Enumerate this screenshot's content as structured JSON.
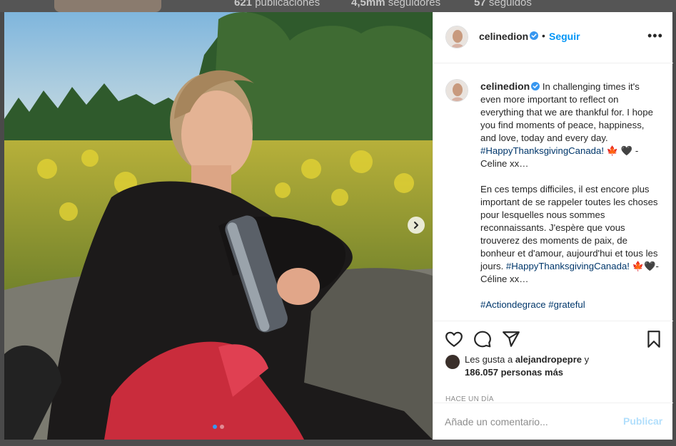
{
  "background_profile": {
    "stats": [
      {
        "value": "621",
        "label": "publicaciones"
      },
      {
        "value": "4,5mm",
        "label": "seguidores"
      },
      {
        "value": "57",
        "label": "seguidos"
      }
    ]
  },
  "post": {
    "username": "celinedion",
    "follow_label": "Seguir",
    "bullet": "•",
    "more_label": "•••",
    "caption": {
      "username": "celinedion",
      "en_text": " In challenging times it's even more important to reflect on everything that we are thankful for.  I hope you find moments of peace, happiness, and love, today and every day. ",
      "en_hashtag": "#HappyThanksgivingCanada!",
      "en_sign": " 🍁 🖤 - Celine xx…",
      "fr_text": "En ces temps difficiles, il est encore plus important de se rappeler toutes les choses pour lesquelles nous sommes reconnaissants. J'espère que vous trouverez des moments de paix, de bonheur et d'amour, aujourd'hui et tous les jours. ",
      "fr_hashtag": "#HappyThanksgivingCanada!",
      "fr_sign": " 🍁🖤- Céline xx…",
      "tags_line": "#Actiondegrace #grateful"
    },
    "likes": {
      "prefix": "Les gusta a ",
      "user": "alejandropepre",
      "conj": " y",
      "count": "186.057 personas más"
    },
    "time": "HACE UN DÍA",
    "comment_placeholder": "Añade un comentario...",
    "publish_label": "Publicar",
    "carousel": {
      "current": 1,
      "total": 2
    }
  },
  "colors": {
    "accent": "#0095f6",
    "hashtag": "#00376b",
    "publish_disabled": "#b2dffc"
  }
}
